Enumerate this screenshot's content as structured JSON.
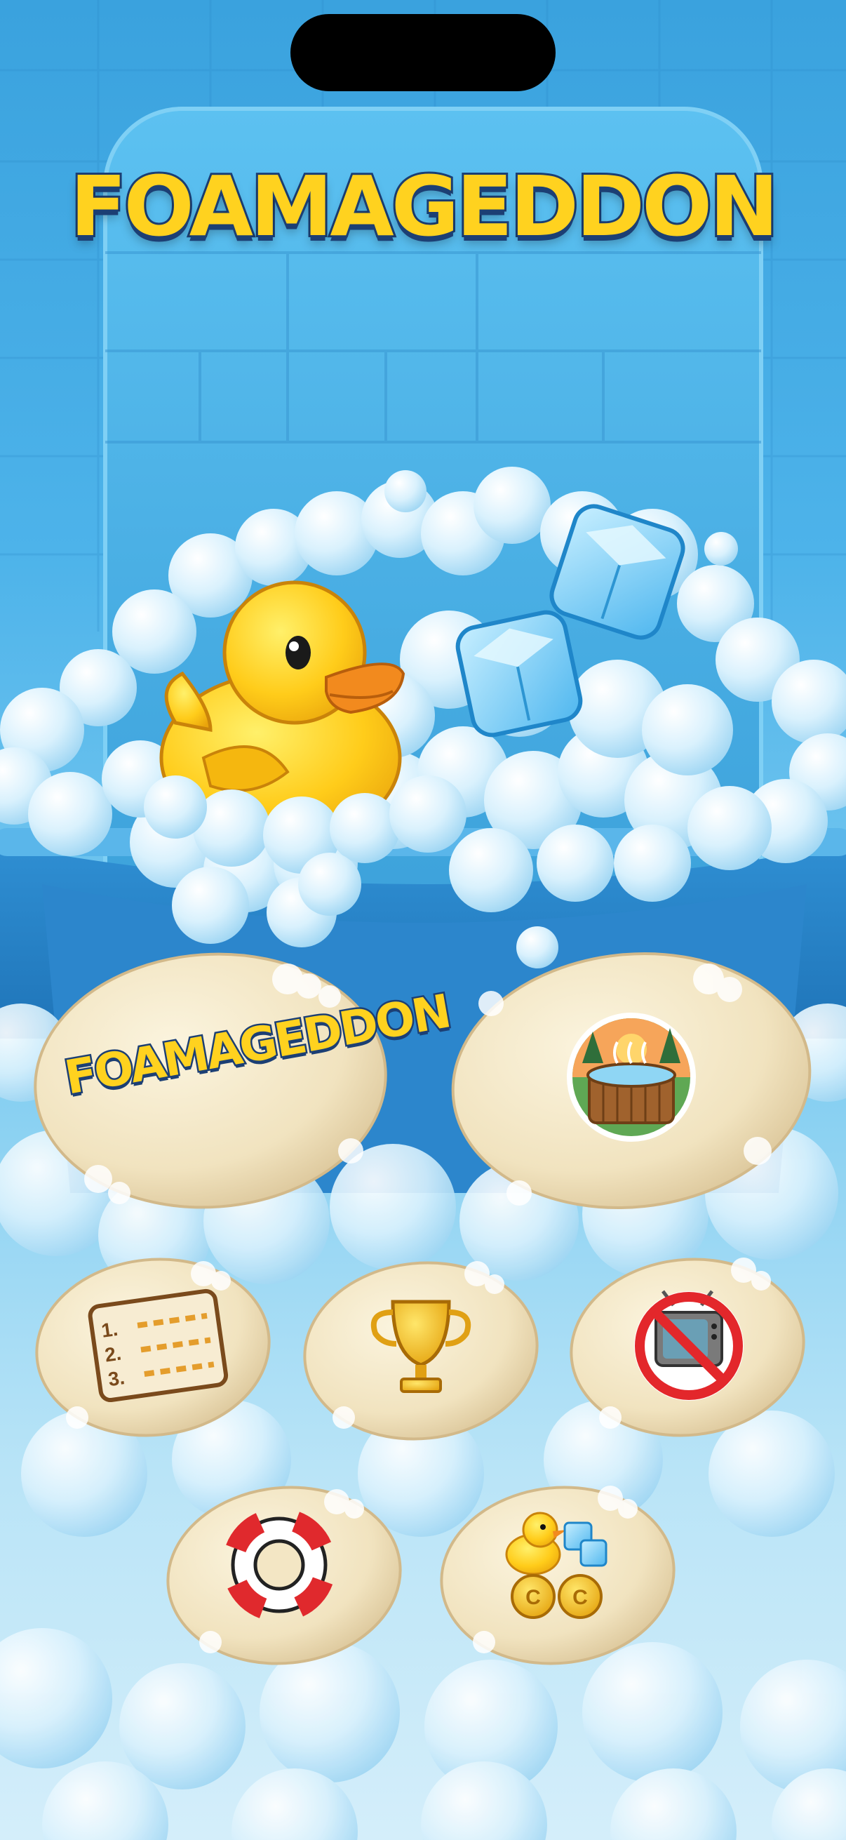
{
  "game": {
    "title": "FOAMAGEDDON",
    "logo_text": "FOAMAGEDDON"
  },
  "menu": {
    "play_button": {
      "icon": "logo-text"
    },
    "buttons": [
      {
        "name": "hot-tub-button",
        "icon": "hot-tub-icon"
      },
      {
        "name": "rules-button",
        "icon": "numbered-list-icon",
        "list_numbers": [
          "1.",
          "2.",
          "3."
        ]
      },
      {
        "name": "trophy-button",
        "icon": "trophy-icon"
      },
      {
        "name": "no-ads-button",
        "icon": "no-tv-icon"
      },
      {
        "name": "help-button",
        "icon": "life-ring-icon"
      },
      {
        "name": "shop-button",
        "icon": "duck-ice-coins-icon",
        "coin_letters": [
          "C",
          "C"
        ]
      }
    ]
  },
  "colors": {
    "sky_blue": "#3aa2de",
    "foam": "#e9f7ff",
    "soap": "#f3e6c4",
    "title_yellow": "#ffd21f",
    "title_outline": "#1c3f74",
    "duck_yellow": "#ffcc1a",
    "beak_orange": "#f28a1e",
    "ice_blue": "#7fd3fb"
  }
}
